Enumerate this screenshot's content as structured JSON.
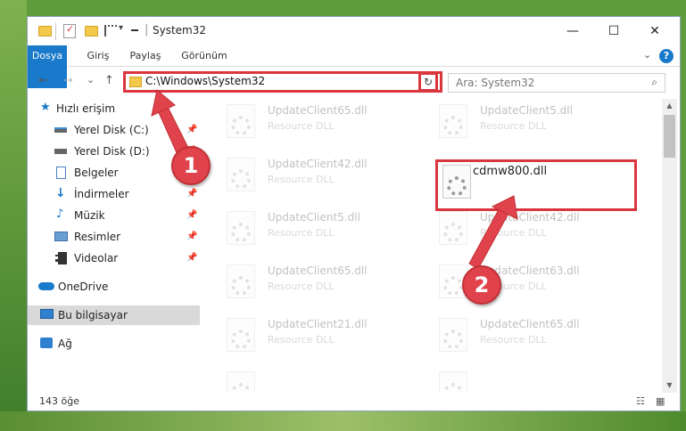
{
  "window": {
    "title": "System32",
    "title_separator": "|"
  },
  "titlebar": {
    "minimize": "—",
    "maximize": "☐",
    "close": "✕",
    "dropdown": "▾",
    "checkmark": "✓"
  },
  "ribbon": {
    "tabs": [
      "Dosya",
      "Giriş",
      "Paylaş",
      "Görünüm"
    ],
    "collapse": "⌄",
    "help": "?"
  },
  "navigation": {
    "back": "←",
    "forward": "→",
    "recent": "⌄",
    "up": "↑",
    "address": "C:\\Windows\\System32",
    "address_dropdown": "⌄",
    "refresh": "↻",
    "search_placeholder": "Ara: System32",
    "search_icon_glyph": "⌕"
  },
  "sidebar": {
    "items": [
      {
        "label": "Hızlı erişim",
        "icon": "star-icon",
        "pinned": false
      },
      {
        "label": "Yerel Disk (C:)",
        "icon": "drive-icon",
        "pinned": true
      },
      {
        "label": "Yerel Disk (D:)",
        "icon": "drive-icon",
        "pinned": true
      },
      {
        "label": "Belgeler",
        "icon": "documents-icon",
        "pinned": true
      },
      {
        "label": "İndirmeler",
        "icon": "download-icon",
        "pinned": true
      },
      {
        "label": "Müzik",
        "icon": "music-icon",
        "pinned": true
      },
      {
        "label": "Resimler",
        "icon": "pictures-icon",
        "pinned": true
      },
      {
        "label": "Videolar",
        "icon": "videos-icon",
        "pinned": true
      },
      {
        "label": "OneDrive",
        "icon": "cloud-icon",
        "pinned": false
      },
      {
        "label": "Bu bilgisayar",
        "icon": "computer-icon",
        "pinned": false,
        "selected": true
      },
      {
        "label": "Ağ",
        "icon": "network-icon",
        "pinned": false
      }
    ],
    "pin_glyph": "📌"
  },
  "files": [
    {
      "name": "UpdateClient65.dll",
      "type": "Resource DLL",
      "faded": true
    },
    {
      "name": "UpdateClient5.dll",
      "type": "Resource DLL",
      "faded": true
    },
    {
      "name": "UpdateClient42.dll",
      "type": "Resource DLL",
      "faded": true
    },
    {
      "name": "cdmw800.dll",
      "type": "",
      "faded": false,
      "highlighted": true
    },
    {
      "name": "UpdateClient5.dll",
      "type": "Resource DLL",
      "faded": true
    },
    {
      "name": "UpdateClient42.dll",
      "type": "Resource DLL",
      "faded": true
    },
    {
      "name": "UpdateClient65.dll",
      "type": "Resource DLL",
      "faded": true
    },
    {
      "name": "UpdateClient63.dll",
      "type": "Resource DLL",
      "faded": true
    },
    {
      "name": "UpdateClient21.dll",
      "type": "Resource DLL",
      "faded": true
    },
    {
      "name": "UpdateClient65.dll",
      "type": "Resource DLL",
      "faded": true
    }
  ],
  "scrollbar": {
    "up": "▲",
    "down": "▼"
  },
  "statusbar": {
    "item_count": "143 öğe",
    "details_view": "☷",
    "icons_view": "▦"
  },
  "annotations": {
    "markers": [
      "1",
      "2"
    ],
    "color": "#e0434b"
  },
  "colors": {
    "file_tab": "#1979ca",
    "highlight": "#d9363e",
    "selected_nav": "#d9d9d9"
  }
}
